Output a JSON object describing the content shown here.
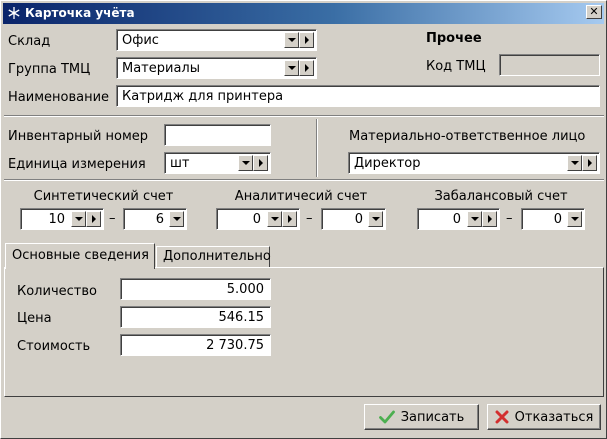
{
  "window": {
    "title": "Карточка учёта",
    "close_glyph": "✕"
  },
  "form": {
    "warehouse": {
      "label": "Склад",
      "value": "Офис"
    },
    "group": {
      "label": "Группа ТМЦ",
      "value": "Материалы"
    },
    "name": {
      "label": "Наименование",
      "value": "Катридж для принтера"
    },
    "other_section": {
      "title": "Прочее",
      "code_label": "Код ТМЦ",
      "code_value": ""
    },
    "inventory_number": {
      "label": "Инвентарный номер",
      "value": ""
    },
    "unit": {
      "label": "Единица измерения",
      "value": "шт"
    },
    "responsible_person": {
      "label": "Материально-ответственное лицо",
      "value": "Директор"
    }
  },
  "accounts": {
    "synthetic": {
      "label": "Синтетический счет",
      "first": "10",
      "second": "6"
    },
    "analytic": {
      "label": "Аналитичесий счет",
      "first": "0",
      "second": "0"
    },
    "off_balance": {
      "label": "Забалансовый счет",
      "first": "0",
      "second": "0"
    },
    "separator": "–"
  },
  "tabs": [
    {
      "label": "Основные сведения",
      "active": true
    },
    {
      "label": "Дополнительно",
      "active": false
    }
  ],
  "details": {
    "quantity": {
      "label": "Количество",
      "value": "5.000"
    },
    "price": {
      "label": "Цена",
      "value": "546.15"
    },
    "cost": {
      "label": "Стоимость",
      "value": "2 730.75"
    }
  },
  "buttons": {
    "save": {
      "label": "Записать",
      "icon": "check-icon",
      "color": "#4caf50"
    },
    "cancel": {
      "label": "Отказаться",
      "icon": "cross-icon",
      "color": "#d32f2f"
    }
  },
  "colors": {
    "titlebar_start": "#0a246a",
    "titlebar_end": "#a6caf0",
    "face": "#d4d0c8"
  }
}
